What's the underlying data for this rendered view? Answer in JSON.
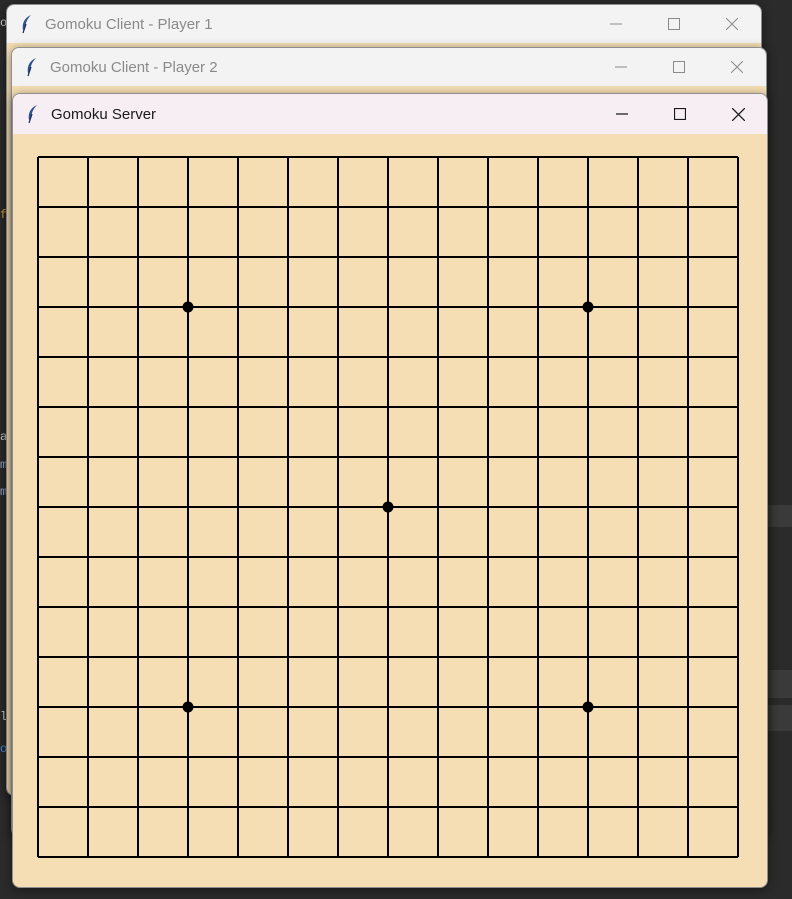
{
  "windows": {
    "player1": {
      "title": "Gomoku Client - Player 1"
    },
    "player2": {
      "title": "Gomoku Client - Player 2"
    },
    "server": {
      "title": "Gomoku Server"
    }
  },
  "background_fragments": [
    "o",
    "f",
    "a",
    "m",
    "m",
    "li",
    "o"
  ],
  "board": {
    "size": 15,
    "background_color": "#f5deb3",
    "line_color": "#000000",
    "star_points": [
      [
        3,
        3
      ],
      [
        11,
        3
      ],
      [
        7,
        7
      ],
      [
        3,
        11
      ],
      [
        11,
        11
      ]
    ]
  },
  "icons": {
    "app": "feather-icon",
    "minimize": "minimize-icon",
    "maximize": "maximize-icon",
    "close": "close-icon"
  }
}
